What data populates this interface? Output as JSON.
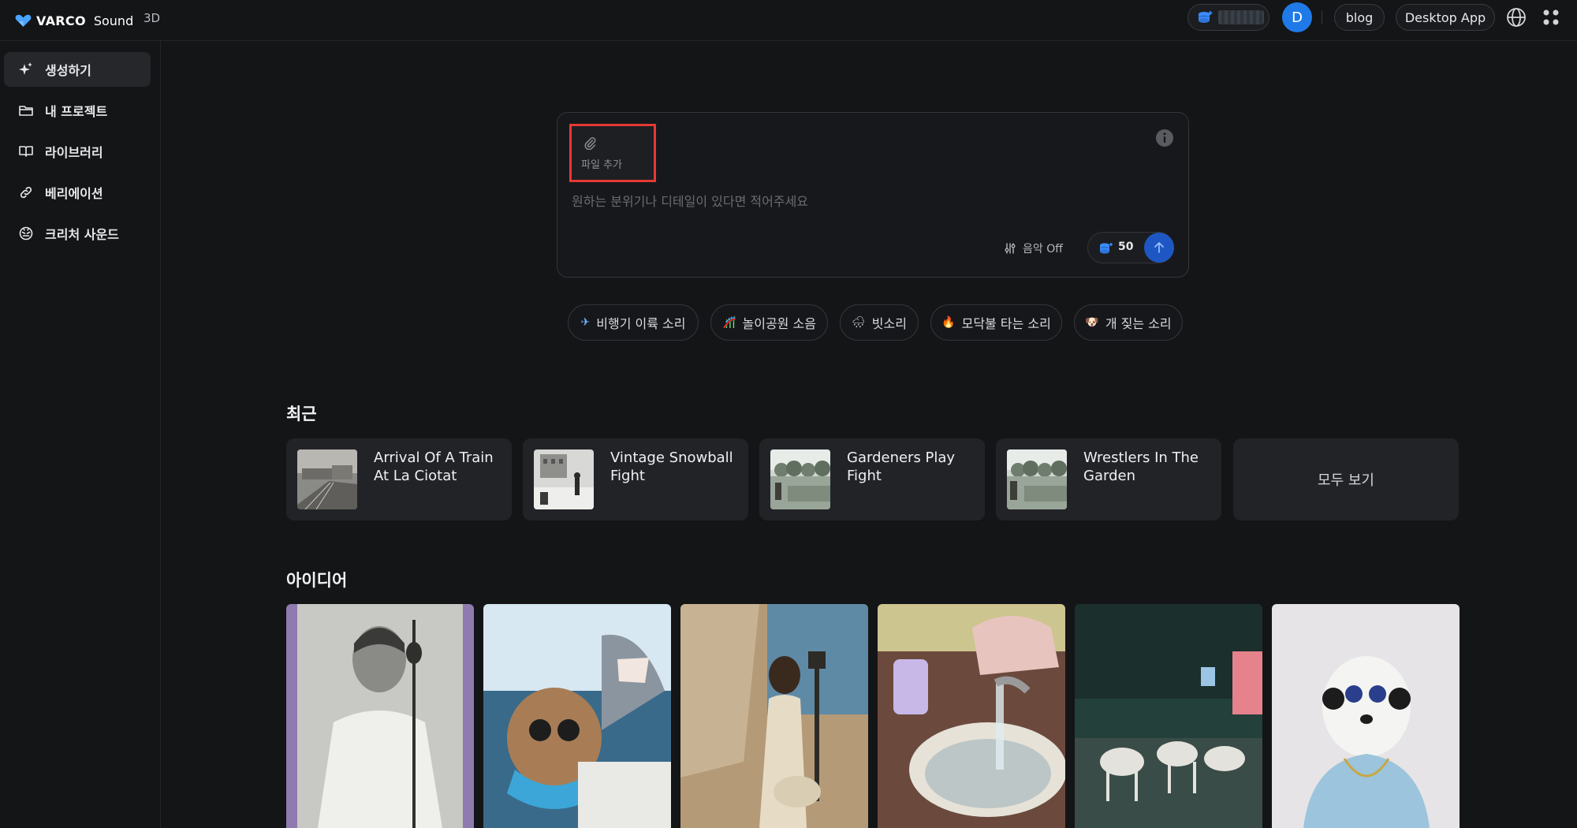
{
  "header": {
    "brand": "VARCO",
    "brand_sub": "Sound",
    "tab_3d": "3D",
    "avatar_initial": "D",
    "blog": "blog",
    "desktop_app": "Desktop App"
  },
  "sidebar": {
    "items": [
      {
        "label": "생성하기",
        "icon": "sparkles-icon",
        "active": true
      },
      {
        "label": "내 프로젝트",
        "icon": "folder-icon"
      },
      {
        "label": "라이브러리",
        "icon": "book-icon"
      },
      {
        "label": "베리에이션",
        "icon": "link-icon"
      },
      {
        "label": "크리처 사운드",
        "icon": "creature-icon"
      }
    ]
  },
  "prompt": {
    "attach_label": "파일 추가",
    "placeholder": "원하는 분위기나 디테일이 있다면 적어주세요",
    "music_toggle": "음악 Off",
    "cost": "50"
  },
  "chips": [
    {
      "emoji": "✈",
      "label": "비행기 이륙 소리"
    },
    {
      "emoji": "🎢",
      "label": "놀이공원 소음"
    },
    {
      "emoji": "🌧",
      "label": "빗소리"
    },
    {
      "emoji": "🔥",
      "label": "모닥불 타는 소리"
    },
    {
      "emoji": "🐶",
      "label": "개 짖는 소리"
    }
  ],
  "recent": {
    "title": "최근",
    "items": [
      {
        "title": "Arrival Of A Train At La Ciotat"
      },
      {
        "title": "Vintage Snowball Fight"
      },
      {
        "title": "Gardeners Play Fight"
      },
      {
        "title": "Wrestlers In The Garden"
      }
    ],
    "see_all": "모두 보기"
  },
  "ideas": {
    "title": "아이디어"
  },
  "colors": {
    "background": "#141517",
    "accent": "#1f7ae8",
    "send": "#1e57c4",
    "highlight": "#e53935"
  }
}
